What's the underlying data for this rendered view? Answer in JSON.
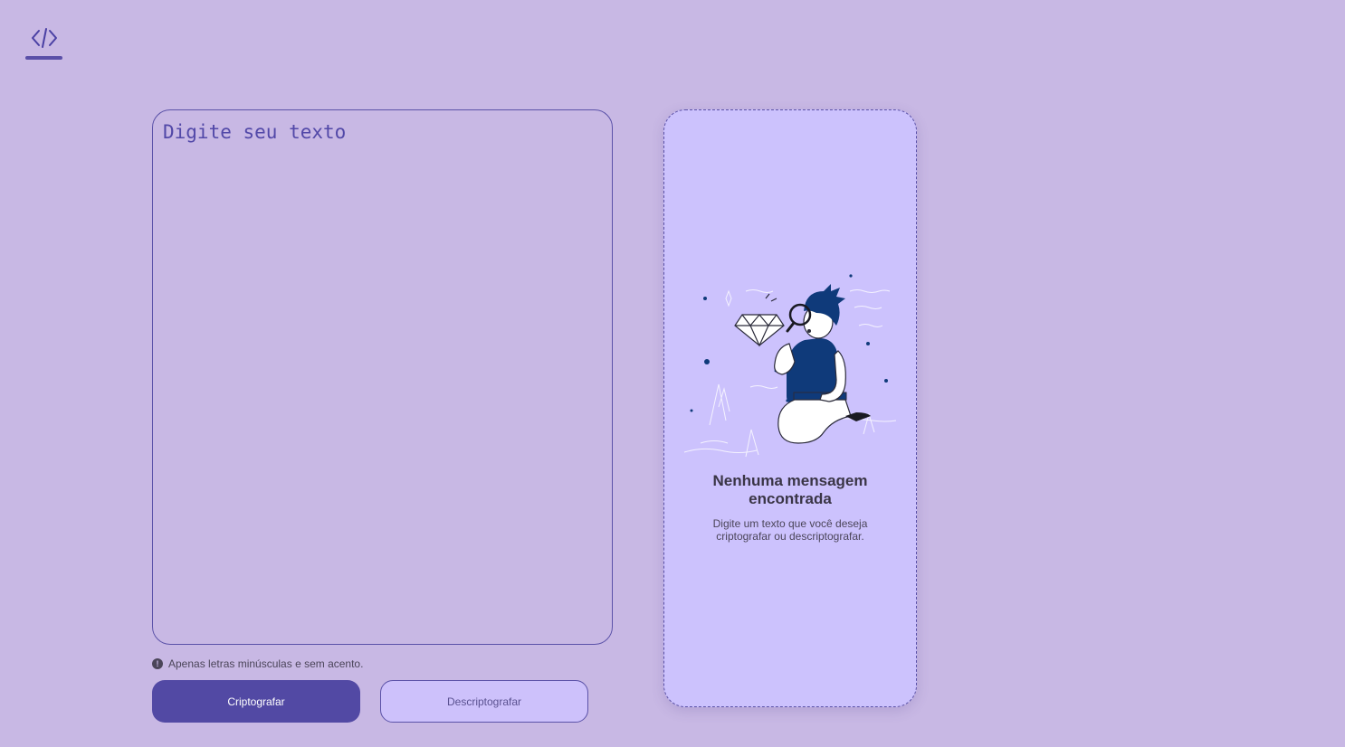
{
  "header": {
    "logo_icon": "code-icon",
    "logo_text": "</>"
  },
  "input": {
    "placeholder": "Digite seu texto",
    "value": ""
  },
  "hint": {
    "icon": "info-icon",
    "text": "Apenas letras minúsculas e sem acento."
  },
  "actions": {
    "encrypt_label": "Criptografar",
    "decrypt_label": "Descriptografar"
  },
  "output": {
    "illustration": "person-searching-diamond-illustration",
    "empty_title": "Nenhuma mensagem encontrada",
    "empty_description": "Digite um texto que você deseja criptografar ou descriptografar."
  },
  "colors": {
    "background": "#c8b8e4",
    "accent": "#5249a4",
    "panel": "#ccc2fd",
    "text_dark": "#3a3546",
    "illustration_navy": "#0f3a7a"
  }
}
